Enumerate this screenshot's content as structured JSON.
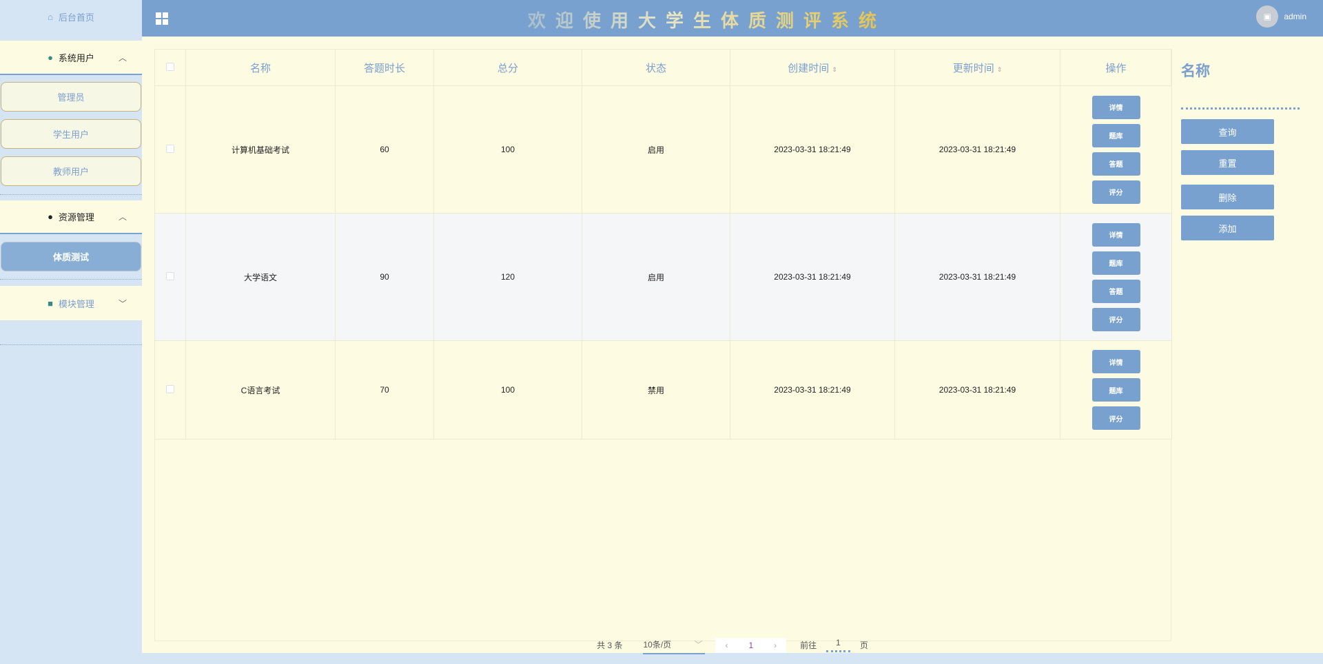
{
  "sidebar": {
    "home": "后台首页",
    "sections": [
      {
        "label": "系统用户",
        "items": [
          "管理员",
          "学生用户",
          "教师用户"
        ]
      },
      {
        "label": "资源管理",
        "items": [
          "体质测试"
        ]
      },
      {
        "label": "模块管理",
        "items": []
      }
    ]
  },
  "header": {
    "title": "欢迎使用大学生体质测评系统",
    "user": "admin"
  },
  "table": {
    "columns": [
      "名称",
      "答题时长",
      "总分",
      "状态",
      "创建时间",
      "更新时间",
      "操作"
    ],
    "rows": [
      {
        "name": "计算机基础考试",
        "duration": "60",
        "score": "100",
        "status": "启用",
        "created": "2023-03-31 18:21:49",
        "updated": "2023-03-31 18:21:49",
        "actions": [
          "详情",
          "题库",
          "答题",
          "评分"
        ]
      },
      {
        "name": "大学语文",
        "duration": "90",
        "score": "120",
        "status": "启用",
        "created": "2023-03-31 18:21:49",
        "updated": "2023-03-31 18:21:49",
        "actions": [
          "详情",
          "题库",
          "答题",
          "评分"
        ]
      },
      {
        "name": "C语言考试",
        "duration": "70",
        "score": "100",
        "status": "禁用",
        "created": "2023-03-31 18:21:49",
        "updated": "2023-03-31 18:21:49",
        "actions": [
          "详情",
          "题库",
          "评分"
        ]
      }
    ]
  },
  "panel": {
    "title": "名称",
    "buttons": [
      "查询",
      "重置",
      "删除",
      "添加"
    ]
  },
  "pagination": {
    "total": "共 3 条",
    "page_size": "10条/页",
    "current": "1",
    "goto_label": "前往",
    "goto_value": "1",
    "page_suffix": "页"
  }
}
